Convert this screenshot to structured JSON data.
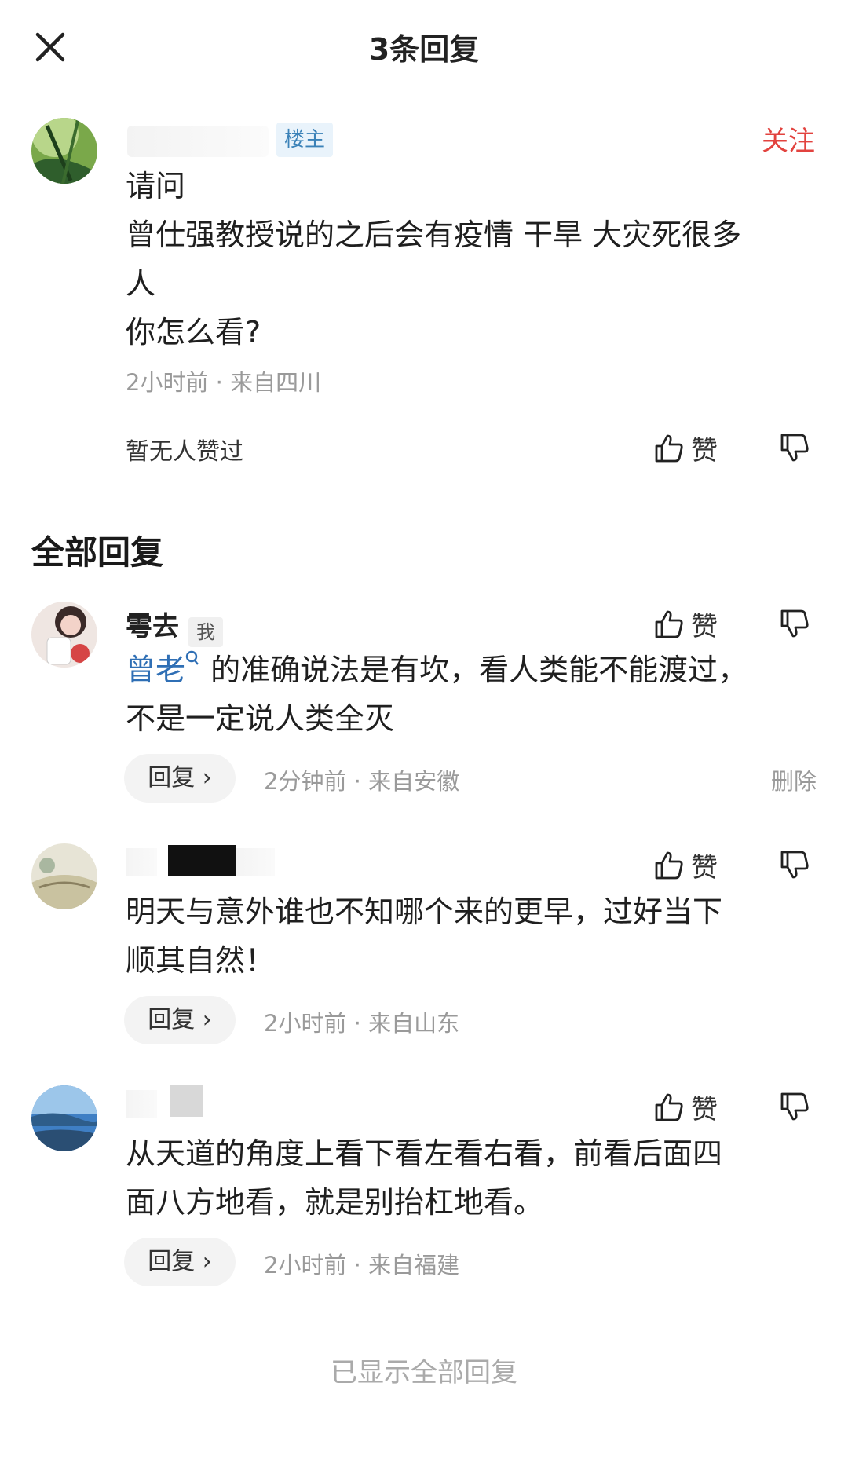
{
  "header": {
    "title": "3条回复"
  },
  "post": {
    "badge": "楼主",
    "follow_label": "关注",
    "lines": [
      "请问",
      "曾仕强教授说的之后会有疫情 干旱 大灾死很多",
      "人",
      "你怎么看?"
    ],
    "meta": "2小时前 · 来自四川",
    "no_likes": "暂无人赞过",
    "like_label": "赞"
  },
  "section": {
    "title": "全部回复"
  },
  "replies": [
    {
      "username": "雩去",
      "badge": "我",
      "mention": "曾老",
      "line1_rest": "的准确说法是有坎，看人类能不能渡过，",
      "line2": "不是一定说人类全灭",
      "reply_label": "回复",
      "meta": "2分钟前 · 来自安徽",
      "delete_label": "删除",
      "like_label": "赞"
    },
    {
      "lines": [
        "明天与意外谁也不知哪个来的更早，过好当下",
        "顺其自然！"
      ],
      "reply_label": "回复",
      "meta": "2小时前 · 来自山东",
      "like_label": "赞"
    },
    {
      "lines": [
        "从天道的角度上看下看左看右看，前看后面四",
        "面八方地看，就是别抬杠地看。"
      ],
      "reply_label": "回复",
      "meta": "2小时前 · 来自福建",
      "like_label": "赞"
    }
  ],
  "footer": {
    "note": "已显示全部回复"
  }
}
